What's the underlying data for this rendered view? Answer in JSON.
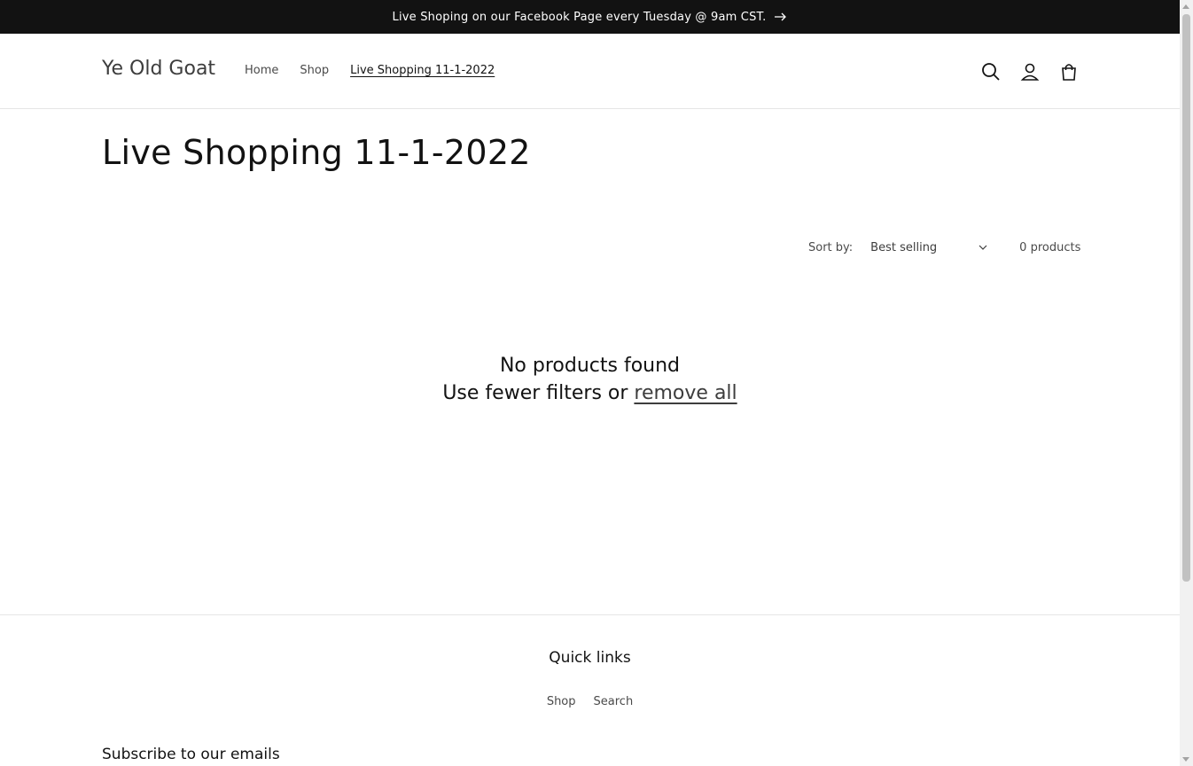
{
  "announcement": {
    "text": "Live Shoping on our Facebook Page every Tuesday @ 9am CST.",
    "icon": "arrow-right-icon"
  },
  "header": {
    "logo": "Ye Old Goat",
    "nav": [
      {
        "label": "Home",
        "active": false
      },
      {
        "label": "Shop",
        "active": false
      },
      {
        "label": "Live Shopping 11-1-2022",
        "active": true
      }
    ],
    "icons": [
      "search-icon",
      "account-icon",
      "cart-icon"
    ]
  },
  "collection": {
    "title": "Live Shopping 11-1-2022",
    "sort_label": "Sort by:",
    "sort_value": "Best selling",
    "product_count": "0 products"
  },
  "empty_state": {
    "line1": "No products found",
    "line2_prefix": "Use fewer filters or",
    "remove_link": "remove all"
  },
  "footer": {
    "quick_links_title": "Quick links",
    "links": [
      "Shop",
      "Search"
    ],
    "subscribe_title": "Subscribe to our emails"
  },
  "colors": {
    "announcement_bg": "#121212",
    "text": "#121212",
    "border": "#e6e6e6"
  }
}
